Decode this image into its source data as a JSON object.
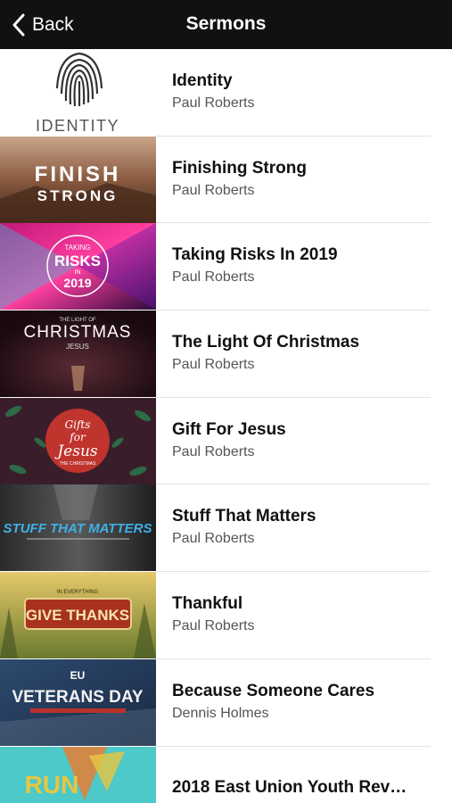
{
  "nav": {
    "back_label": "Back",
    "title": "Sermons"
  },
  "sermons": [
    {
      "title": "Identity",
      "speaker": "Paul Roberts",
      "thumb_text": "IDENTITY"
    },
    {
      "title": "Finishing Strong",
      "speaker": "Paul Roberts",
      "thumb_text": [
        "FINISH",
        "STRONG"
      ]
    },
    {
      "title": "Taking Risks In 2019",
      "speaker": "Paul Roberts",
      "thumb_text": [
        "TAKING",
        "RISKS",
        "IN",
        "2019"
      ]
    },
    {
      "title": "The Light Of Christmas",
      "speaker": "Paul Roberts",
      "thumb_text": [
        "THE LIGHT OF",
        "CHRISTMAS",
        "JESUS"
      ]
    },
    {
      "title": "Gift For Jesus",
      "speaker": "Paul Roberts",
      "thumb_text": [
        "Gifts",
        "for",
        "Jesus",
        "THE CHRISTMAS"
      ]
    },
    {
      "title": "Stuff That Matters",
      "speaker": "Paul Roberts",
      "thumb_text": [
        "STUFF THAT MATTERS"
      ]
    },
    {
      "title": "Thankful",
      "speaker": "Paul Roberts",
      "thumb_text": [
        "IN EVERYTHING",
        "GIVE THANKS"
      ]
    },
    {
      "title": "Because Someone Cares",
      "speaker": "Dennis Holmes",
      "thumb_text": [
        "EU",
        "VETERANS DAY"
      ]
    },
    {
      "title": "2018 East Union Youth Rev…",
      "speaker": "",
      "thumb_text": [
        "RUN"
      ]
    }
  ],
  "colors": {
    "navbar": "#111111",
    "title_text": "#111111",
    "subtitle_text": "#555555"
  }
}
